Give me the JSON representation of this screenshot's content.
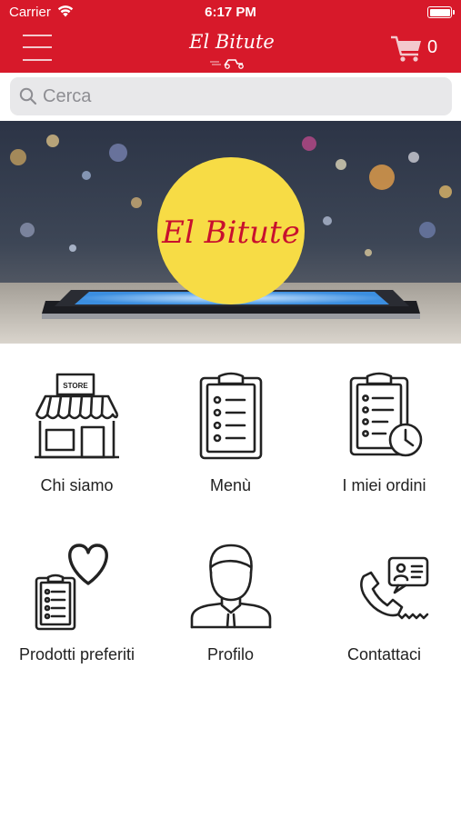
{
  "status_bar": {
    "carrier": "Carrier",
    "time": "6:17 PM"
  },
  "nav": {
    "brand": "El Bitute",
    "cart_count": "0"
  },
  "search": {
    "placeholder": "Cerca",
    "value": ""
  },
  "banner": {
    "logo_text": "El Bitute"
  },
  "menu_tiles": [
    {
      "label": "Chi siamo",
      "icon": "store-icon",
      "store_sign": "STORE"
    },
    {
      "label": "Menù",
      "icon": "clipboard-checklist-icon"
    },
    {
      "label": "I miei ordini",
      "icon": "clipboard-clock-icon"
    },
    {
      "label": "Prodotti preferiti",
      "icon": "clipboard-heart-icon"
    },
    {
      "label": "Profilo",
      "icon": "user-profile-icon"
    },
    {
      "label": "Contattaci",
      "icon": "phone-contact-icon"
    }
  ],
  "colors": {
    "brand_red": "#d7192a",
    "logo_yellow": "#f7dc45",
    "logo_red": "#c8102e"
  }
}
